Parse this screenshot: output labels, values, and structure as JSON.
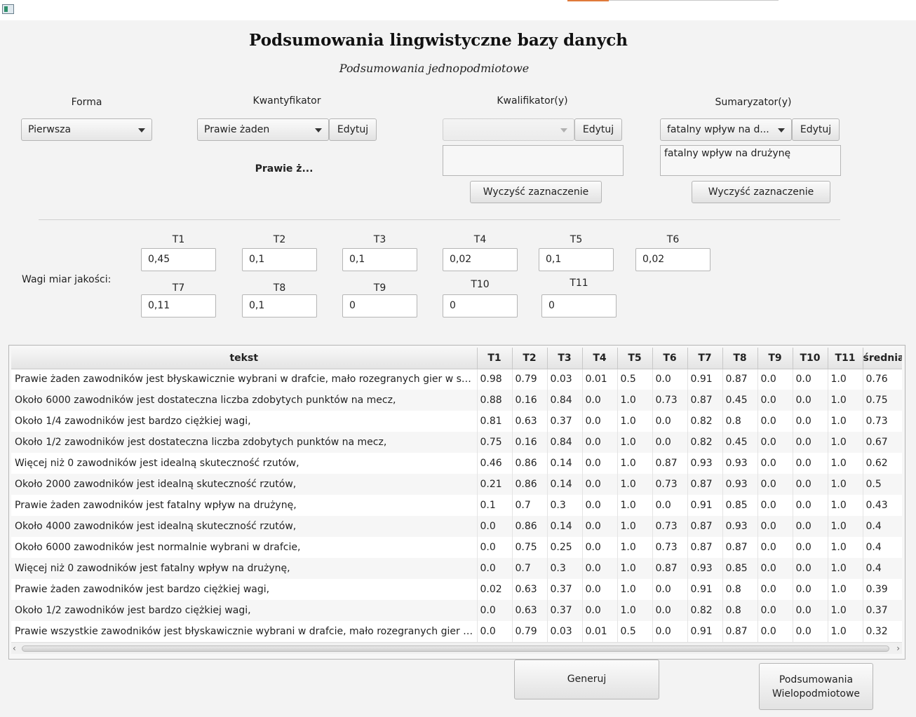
{
  "window": {
    "icon": "app-window-icon"
  },
  "header": {
    "title": "Podsumowania lingwistyczne bazy danych",
    "subtitle": "Podsumowania jednopodmiotowe"
  },
  "forma": {
    "label": "Forma",
    "value": "Pierwsza"
  },
  "kwantyfikator": {
    "label": "Kwantyfikator",
    "value": "Prawie żaden",
    "edit_label": "Edytuj",
    "preview": "Prawie ż..."
  },
  "kwalifikator": {
    "label": "Kwalifikator(y)",
    "value": "",
    "edit_label": "Edytuj",
    "list": "",
    "clear_label": "Wyczyść zaznaczenie"
  },
  "sumaryzator": {
    "label": "Sumaryzator(y)",
    "value": "fatalny wpływ na d...",
    "edit_label": "Edytuj",
    "list": "fatalny wpływ na drużynę",
    "clear_label": "Wyczyść zaznaczenie"
  },
  "weights": {
    "label": "Wagi miar jakości:",
    "items": [
      {
        "name": "T1",
        "value": "0,45"
      },
      {
        "name": "T2",
        "value": "0,1"
      },
      {
        "name": "T3",
        "value": "0,1"
      },
      {
        "name": "T4",
        "value": "0,02"
      },
      {
        "name": "T5",
        "value": "0,1"
      },
      {
        "name": "T6",
        "value": "0,02"
      },
      {
        "name": "T7",
        "value": "0,11"
      },
      {
        "name": "T8",
        "value": "0,1"
      },
      {
        "name": "T9",
        "value": "0"
      },
      {
        "name": "T10",
        "value": "0"
      },
      {
        "name": "T11",
        "value": "0"
      }
    ]
  },
  "table": {
    "columns": [
      "tekst",
      "T1",
      "T2",
      "T3",
      "T4",
      "T5",
      "T6",
      "T7",
      "T8",
      "T9",
      "T10",
      "T11",
      "średnia"
    ],
    "rows": [
      [
        "Prawie żaden zawodników  jest błyskawicznie wybrani w drafcie, mało rozegranych gier w sezonie,",
        "0.98",
        "0.79",
        "0.03",
        "0.01",
        "0.5",
        "0.0",
        "0.91",
        "0.87",
        "0.0",
        "0.0",
        "1.0",
        "0.76"
      ],
      [
        "Około 6000 zawodników  jest dostateczna liczba zdobytych punktów na mecz,",
        "0.88",
        "0.16",
        "0.84",
        "0.0",
        "1.0",
        "0.73",
        "0.87",
        "0.45",
        "0.0",
        "0.0",
        "1.0",
        "0.75"
      ],
      [
        "Około 1/4 zawodników  jest bardzo ciężkiej wagi,",
        "0.81",
        "0.63",
        "0.37",
        "0.0",
        "1.0",
        "0.0",
        "0.82",
        "0.8",
        "0.0",
        "0.0",
        "1.0",
        "0.73"
      ],
      [
        "Około 1/2 zawodników  jest dostateczna liczba zdobytych punktów na mecz,",
        "0.75",
        "0.16",
        "0.84",
        "0.0",
        "1.0",
        "0.0",
        "0.82",
        "0.45",
        "0.0",
        "0.0",
        "1.0",
        "0.67"
      ],
      [
        "Więcej niż 0 zawodników  jest idealną skuteczność rzutów,",
        "0.46",
        "0.86",
        "0.14",
        "0.0",
        "1.0",
        "0.87",
        "0.93",
        "0.93",
        "0.0",
        "0.0",
        "1.0",
        "0.62"
      ],
      [
        "Około 2000 zawodników  jest idealną skuteczność rzutów,",
        "0.21",
        "0.86",
        "0.14",
        "0.0",
        "1.0",
        "0.73",
        "0.87",
        "0.93",
        "0.0",
        "0.0",
        "1.0",
        "0.5"
      ],
      [
        "Prawie żaden zawodników  jest fatalny wpływ na drużynę,",
        "0.1",
        "0.7",
        "0.3",
        "0.0",
        "1.0",
        "0.0",
        "0.91",
        "0.85",
        "0.0",
        "0.0",
        "1.0",
        "0.43"
      ],
      [
        "Około 4000 zawodników  jest idealną skuteczność rzutów,",
        "0.0",
        "0.86",
        "0.14",
        "0.0",
        "1.0",
        "0.73",
        "0.87",
        "0.93",
        "0.0",
        "0.0",
        "1.0",
        "0.4"
      ],
      [
        "Około 6000 zawodników  jest normalnie wybrani w drafcie,",
        "0.0",
        "0.75",
        "0.25",
        "0.0",
        "1.0",
        "0.73",
        "0.87",
        "0.87",
        "0.0",
        "0.0",
        "1.0",
        "0.4"
      ],
      [
        "Więcej niż 0 zawodników  jest fatalny wpływ na drużynę,",
        "0.0",
        "0.7",
        "0.3",
        "0.0",
        "1.0",
        "0.87",
        "0.93",
        "0.85",
        "0.0",
        "0.0",
        "1.0",
        "0.4"
      ],
      [
        "Prawie żaden zawodników  jest bardzo ciężkiej wagi,",
        "0.02",
        "0.63",
        "0.37",
        "0.0",
        "1.0",
        "0.0",
        "0.91",
        "0.8",
        "0.0",
        "0.0",
        "1.0",
        "0.39"
      ],
      [
        "Około 1/2 zawodników  jest bardzo ciężkiej wagi,",
        "0.0",
        "0.63",
        "0.37",
        "0.0",
        "1.0",
        "0.0",
        "0.82",
        "0.8",
        "0.0",
        "0.0",
        "1.0",
        "0.37"
      ],
      [
        "Prawie wszystkie zawodników  jest błyskawicznie wybrani w drafcie, mało rozegranych gier w sez...",
        "0.0",
        "0.79",
        "0.03",
        "0.01",
        "0.5",
        "0.0",
        "0.91",
        "0.87",
        "0.0",
        "0.0",
        "1.0",
        "0.32"
      ]
    ]
  },
  "actions": {
    "generate_label": "Generuj",
    "multi_line1": "Podsumowania",
    "multi_line2": "Wielopodmiotowe"
  },
  "colors": {
    "accent": "#e07a3a",
    "background": "#f3f3f3"
  }
}
